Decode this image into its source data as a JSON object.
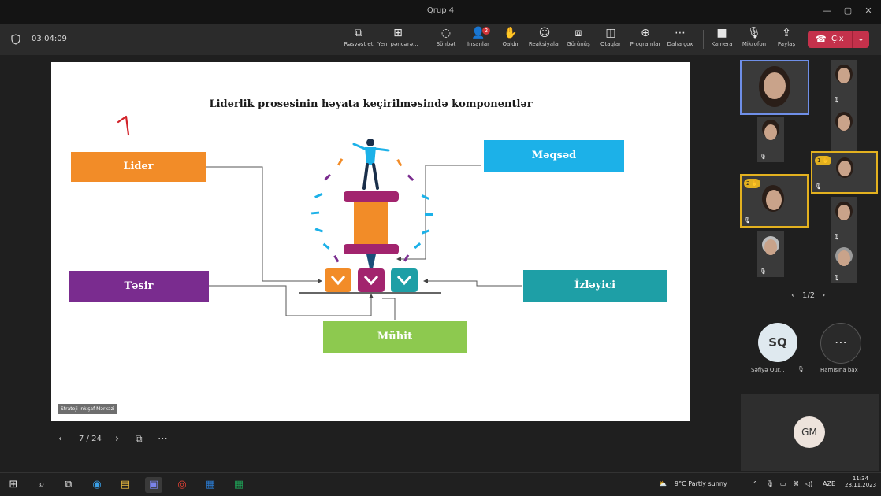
{
  "window": {
    "title": "Qrup 4"
  },
  "toolbar": {
    "timer": "03:04:09",
    "buttons": [
      {
        "label": "Rəsvəst et"
      },
      {
        "label": "Yeni pəncərə..."
      },
      {
        "label": "Söhbət"
      },
      {
        "label": "İnsanlar",
        "badge": "2"
      },
      {
        "label": "Qaldır"
      },
      {
        "label": "Reaksiyalar"
      },
      {
        "label": "Görünüş"
      },
      {
        "label": "Otaqlar"
      },
      {
        "label": "Proqramlar"
      },
      {
        "label": "Daha çox"
      },
      {
        "label": "Kamera"
      },
      {
        "label": "Mikrofon"
      },
      {
        "label": "Paylaş"
      }
    ],
    "leave_label": "Çıx"
  },
  "slide": {
    "title": "Liderlik prosesinin həyata keçirilməsində komponentlər",
    "annotation": "1",
    "boxes": {
      "lider": "Lider",
      "meqsed": "Məqsəd",
      "tesir": "Təsir",
      "izleyici": "İzləyici",
      "muhit": "Mühit"
    },
    "brand": "Strateji İnkişaf Mərkəzi"
  },
  "slide_nav": {
    "page": "7 / 24"
  },
  "gallery": {
    "pager": "1/2",
    "hands": [
      "1",
      "2"
    ],
    "self_initials": "SQ",
    "self_name": "Səfiyə Qur...",
    "more_label": "Hamısına bax",
    "gm_initials": "GM"
  },
  "taskbar": {
    "weather": "9°C  Partly sunny",
    "lang": "AZE",
    "time": "11:34",
    "date": "28.11.2023"
  },
  "colors": {
    "orange": "#f28c28",
    "sky": "#1cb1e8",
    "purple": "#7a2c8f",
    "teal": "#1e9fa6",
    "green": "#8dc94f",
    "magenta": "#a2246e",
    "leave": "#c4314b"
  }
}
